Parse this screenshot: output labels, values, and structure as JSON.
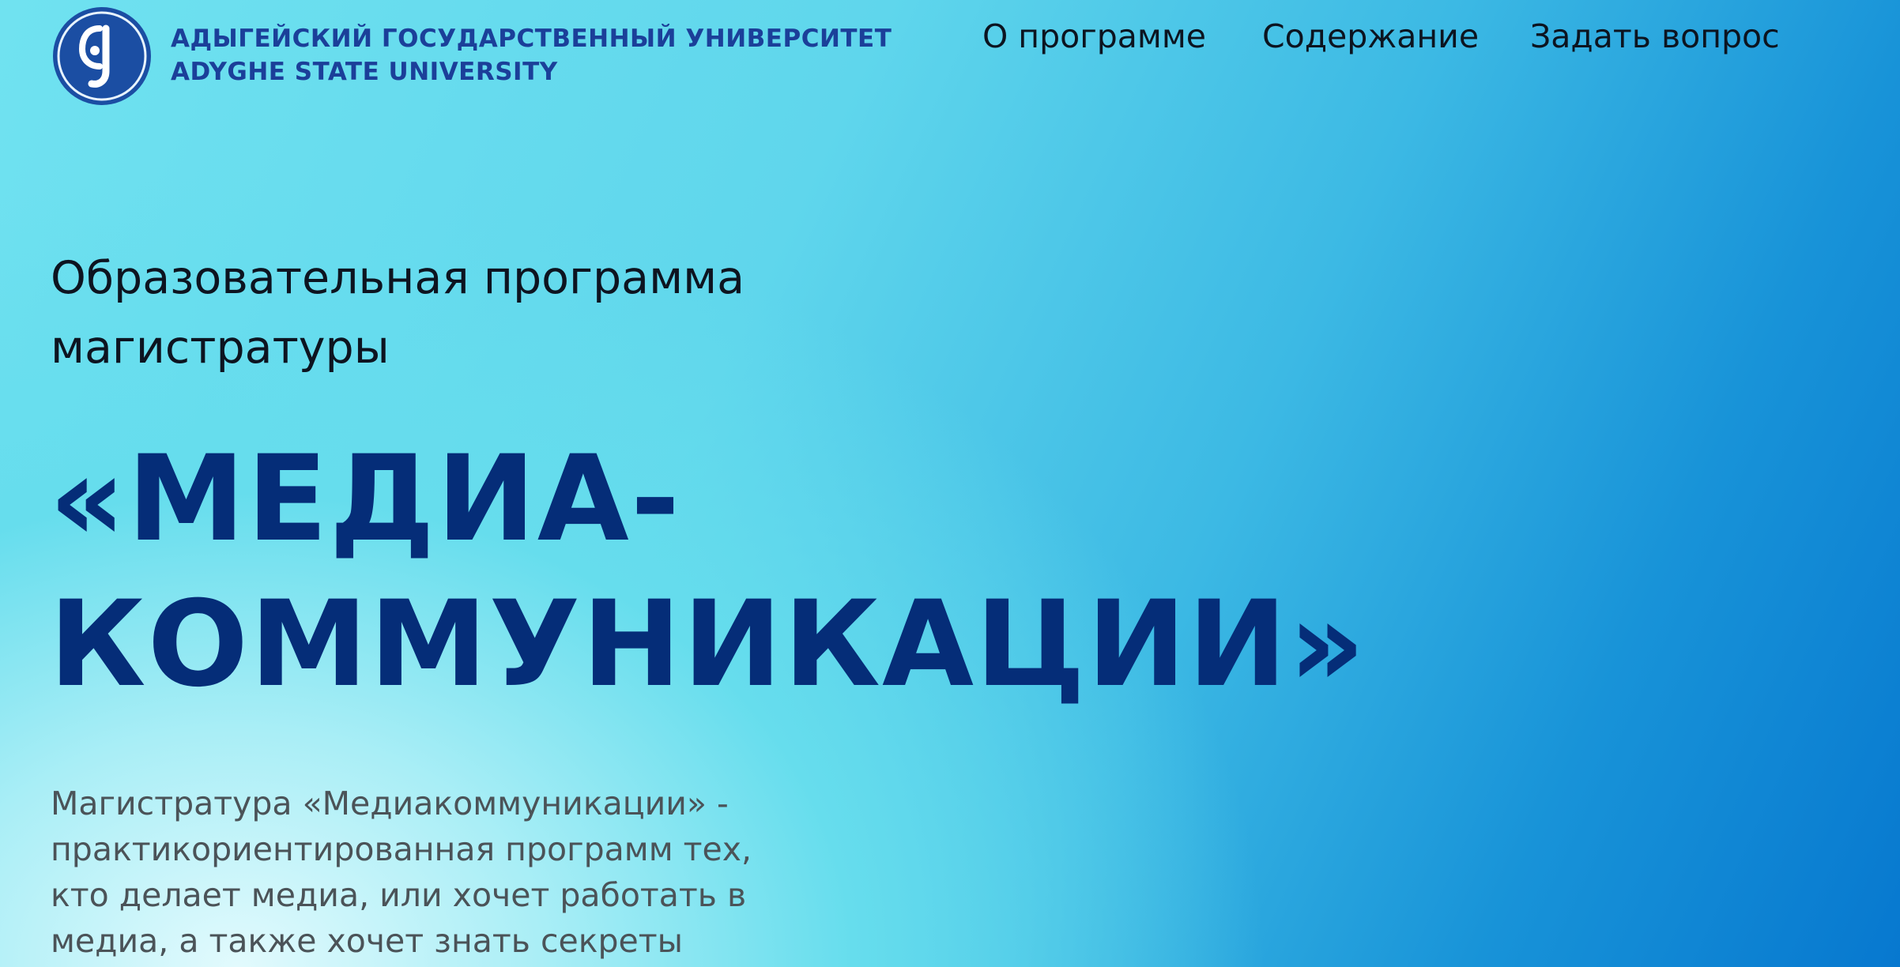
{
  "header": {
    "logo": {
      "icon": "university-emblem-icon",
      "name_ru": "АДЫГЕЙСКИЙ ГОСУДАРСТВЕННЫЙ УНИВЕРСИТЕТ",
      "name_en": "ADYGHE STATE UNIVERSITY",
      "color": "#1b3f99"
    },
    "nav": [
      {
        "label": "О программе"
      },
      {
        "label": "Содержание"
      },
      {
        "label": "Задать вопрос"
      }
    ]
  },
  "hero": {
    "subtitle_line1": "Образовательная программа",
    "subtitle_line2": "магистратуры",
    "title_line1": "«МЕДИА-",
    "title_line2": "КОММУНИКАЦИИ»",
    "title_color": "#052d78",
    "description_lines": [
      "Магистратура «Медиакоммуникации» -",
      "практикориентированная программ тех,",
      "кто делает медиа, или хочет работать в",
      "медиа, а также хочет знать секреты"
    ]
  },
  "colors": {
    "background_light": "#e2fafd",
    "background_mid": "#66dded",
    "background_dark": "#0778cf"
  }
}
